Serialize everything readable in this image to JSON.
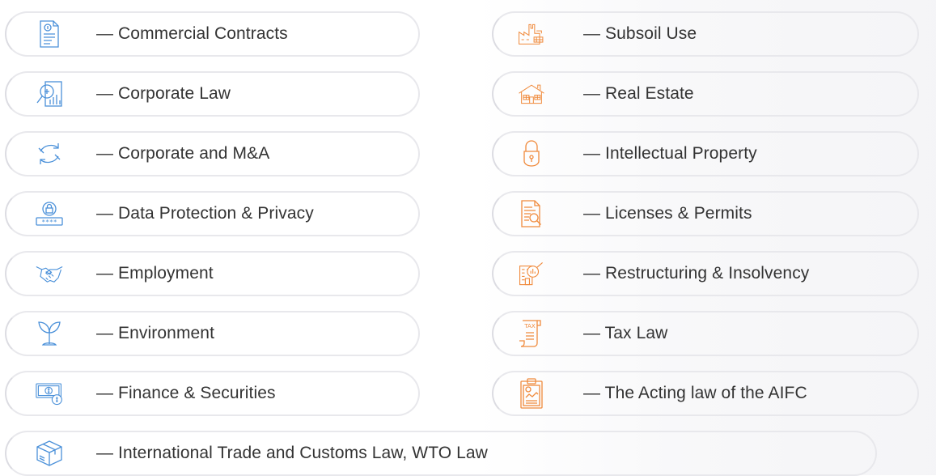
{
  "left_column": [
    {
      "label": "— Commercial Contracts",
      "icon": "contract-document-icon"
    },
    {
      "label": "— Corporate Law",
      "icon": "magnifier-report-icon"
    },
    {
      "label": "— Corporate and M&A",
      "icon": "exchange-arrows-icon"
    },
    {
      "label": "— Data Protection & Privacy",
      "icon": "password-lock-icon"
    },
    {
      "label": "— Employment",
      "icon": "handshake-icon"
    },
    {
      "label": "— Environment",
      "icon": "sprout-icon"
    },
    {
      "label": "— Finance & Securities",
      "icon": "banknote-coin-icon"
    }
  ],
  "right_column": [
    {
      "label": "— Subsoil Use",
      "icon": "factory-icon"
    },
    {
      "label": "— Real Estate",
      "icon": "house-icon"
    },
    {
      "label": "— Intellectual Property",
      "icon": "padlock-icon"
    },
    {
      "label": "— Licenses & Permits",
      "icon": "document-search-icon"
    },
    {
      "label": "— Restructuring & Insolvency",
      "icon": "building-magnifier-icon"
    },
    {
      "label": "— Tax Law",
      "icon": "tax-receipt-icon"
    },
    {
      "label": "— The Acting law of the AIFC",
      "icon": "clipboard-chart-icon"
    }
  ],
  "bottom_row": {
    "label": "— International Trade and Customs Law, WTO Law",
    "icon": "package-box-icon"
  },
  "colors": {
    "blue_icon": "#4a90d9",
    "orange_icon": "#f08a3c",
    "pill_border": "#e8e8ec",
    "text": "#333333"
  },
  "tax_icon_text": "TAX",
  "data_icon_text": "****"
}
